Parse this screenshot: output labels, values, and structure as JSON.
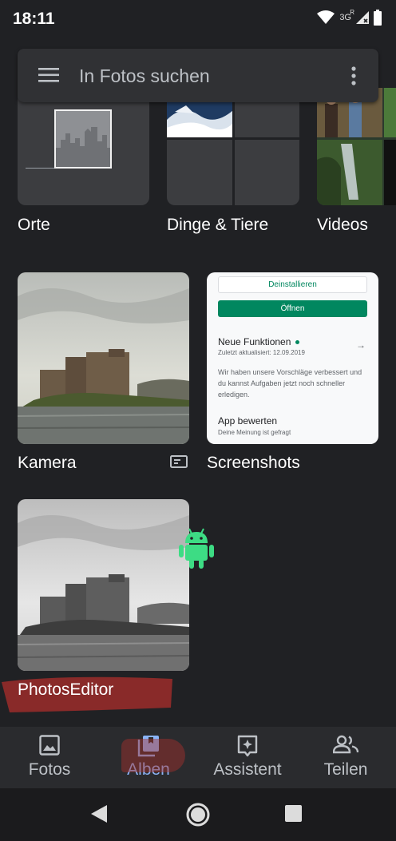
{
  "status_bar": {
    "time": "18:11",
    "network": "3G",
    "network_flag": "R"
  },
  "search": {
    "placeholder": "In Fotos suchen"
  },
  "albums_top": [
    {
      "label": "Orte",
      "icon": "city-placeholder-icon"
    },
    {
      "label": "Dinge & Tiere"
    },
    {
      "label": "Videos"
    }
  ],
  "albums": [
    {
      "label": "Kamera"
    },
    {
      "label": "Screenshots"
    },
    {
      "label": "PhotosEditor"
    }
  ],
  "screenshot_preview": {
    "uninstall": "Deinstallieren",
    "open": "Öffnen",
    "whats_new": "Neue Funktionen",
    "updated": "Zuletzt aktualisiert: 12.09.2019",
    "body": "Wir haben unsere Vorschläge verbessert und du kannst Aufgaben jetzt noch schneller erledigen.",
    "rate": "App bewerten",
    "rate_sub": "Deine Meinung ist gefragt"
  },
  "bottom_nav": [
    {
      "label": "Fotos",
      "icon": "photo-icon",
      "active": false
    },
    {
      "label": "Alben",
      "icon": "album-icon",
      "active": true
    },
    {
      "label": "Assistent",
      "icon": "assistant-icon",
      "active": false
    },
    {
      "label": "Teilen",
      "icon": "people-icon",
      "active": false
    }
  ],
  "colors": {
    "background": "#202124",
    "accent": "#8ab4f8",
    "play_green": "#01875f",
    "android_green": "#3ddc84",
    "highlight": "#a8302c"
  }
}
